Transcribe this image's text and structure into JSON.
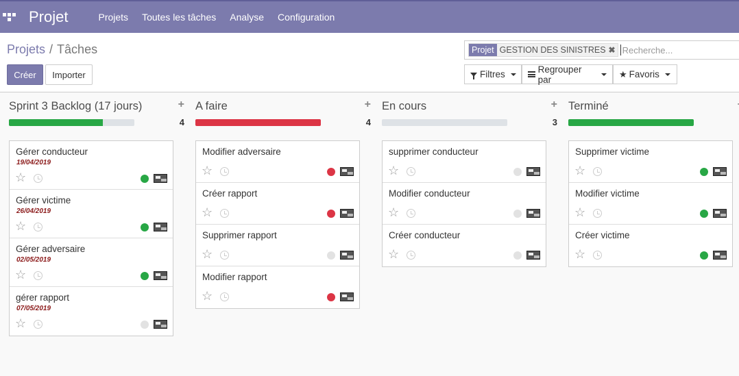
{
  "navbar": {
    "brand": "Projet",
    "menu": [
      "Projets",
      "Toutes les tâches",
      "Analyse",
      "Configuration"
    ]
  },
  "breadcrumb": {
    "parent": "Projets",
    "separator": "/",
    "current": "Tâches"
  },
  "buttons": {
    "create": "Créer",
    "import": "Importer"
  },
  "search": {
    "facet_label": "Projet",
    "facet_value": "GESTION DES SINISTRES",
    "facet_remove": "✖",
    "placeholder": "Recherche..."
  },
  "controls": {
    "filters": "Filtres",
    "group_by": "Regrouper par",
    "favorites": "Favoris"
  },
  "icons": {
    "add": "add-icon",
    "star": "star-icon",
    "clock": "clock-icon"
  },
  "colors": {
    "accent": "#7c7bad",
    "green": "#28a745",
    "red": "#dc3545",
    "grey": "#dee2e6"
  },
  "columns": [
    {
      "title": "Sprint 3 Backlog (17 jours)",
      "count": "4",
      "progress": {
        "fraction": 0.75,
        "color": "#28a745"
      },
      "cards": [
        {
          "title": "Gérer conducteur",
          "date": "19/04/2019",
          "state": "green"
        },
        {
          "title": "Gérer victime",
          "date": "26/04/2019",
          "state": "green"
        },
        {
          "title": "Gérer adversaire",
          "date": "02/05/2019",
          "state": "green"
        },
        {
          "title": "gérer rapport",
          "date": "07/05/2019",
          "state": "grey"
        }
      ]
    },
    {
      "title": "A faire",
      "count": "4",
      "progress": {
        "fraction": 1.0,
        "color": "#dc3545"
      },
      "cards": [
        {
          "title": "Modifier adversaire",
          "date": "",
          "state": "red"
        },
        {
          "title": "Créer rapport",
          "date": "",
          "state": "red"
        },
        {
          "title": "Supprimer rapport",
          "date": "",
          "state": "grey"
        },
        {
          "title": "Modifier rapport",
          "date": "",
          "state": "red"
        }
      ]
    },
    {
      "title": "En cours",
      "count": "3",
      "progress": {
        "fraction": 0.0,
        "color": "#28a745"
      },
      "cards": [
        {
          "title": "supprimer conducteur",
          "date": "",
          "state": "grey"
        },
        {
          "title": "Modifier conducteur",
          "date": "",
          "state": "grey"
        },
        {
          "title": "Créer conducteur",
          "date": "",
          "state": "grey"
        }
      ]
    },
    {
      "title": "Terminé",
      "count": "3",
      "progress": {
        "fraction": 1.0,
        "color": "#28a745"
      },
      "cards": [
        {
          "title": "Supprimer victime",
          "date": "",
          "state": "green"
        },
        {
          "title": "Modifier victime",
          "date": "",
          "state": "green"
        },
        {
          "title": "Créer victime",
          "date": "",
          "state": "green"
        }
      ]
    }
  ]
}
